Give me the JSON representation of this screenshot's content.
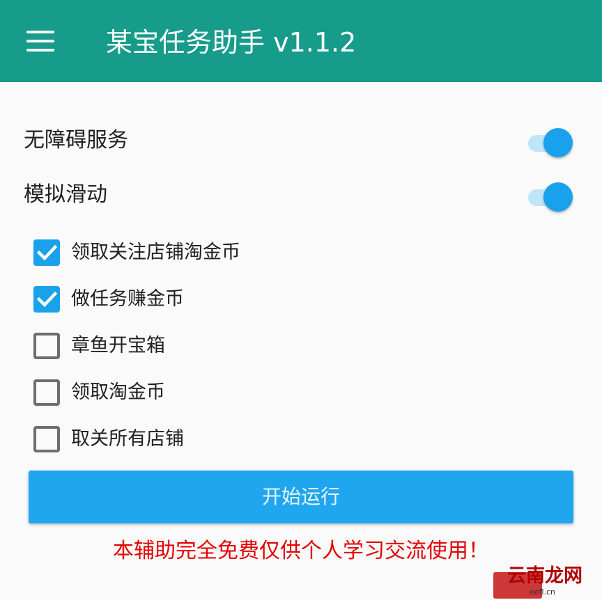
{
  "app": {
    "title": "某宝任务助手 v1.1.2",
    "theme_color": "#179b8a",
    "accent_color": "#1aa1ec",
    "menu_icon": "hamburger-menu-icon"
  },
  "switches": [
    {
      "label": "无障碍服务",
      "on": true
    },
    {
      "label": "模拟滑动",
      "on": true
    }
  ],
  "tasks": [
    {
      "label": "领取关注店铺淘金币",
      "checked": true
    },
    {
      "label": "做任务赚金币",
      "checked": true
    },
    {
      "label": "章鱼开宝箱",
      "checked": false
    },
    {
      "label": "领取淘金币",
      "checked": false
    },
    {
      "label": "取关所有店铺",
      "checked": false
    }
  ],
  "run_button": {
    "label": "开始运行"
  },
  "disclaimer": {
    "text": "本辅助完全免费仅供个人学习交流使用！",
    "color": "#e60000"
  },
  "watermark": {
    "text": "云南龙网",
    "domain": "eefl.cn"
  }
}
